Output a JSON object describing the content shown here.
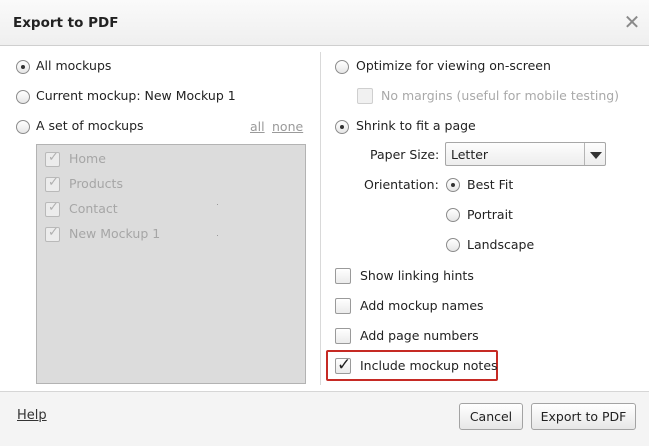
{
  "dialog": {
    "title": "Export to PDF",
    "close_icon": "close-icon"
  },
  "left": {
    "scope_options": [
      {
        "label": "All mockups",
        "selected": true
      },
      {
        "label": "Current mockup: New Mockup 1",
        "selected": false
      },
      {
        "label": "A set of mockups",
        "selected": false
      }
    ],
    "select_all_link": "all",
    "select_none_link": "none",
    "mockup_list": [
      {
        "label": "Home",
        "checked": true
      },
      {
        "label": "Products",
        "checked": true
      },
      {
        "label": "Contact",
        "checked": true
      },
      {
        "label": "New Mockup 1",
        "checked": true
      }
    ]
  },
  "right": {
    "optimize_label": "Optimize for viewing on-screen",
    "no_margins_label": "No margins (useful for mobile testing)",
    "shrink_label": "Shrink to fit a page",
    "paper_size_label": "Paper Size:",
    "paper_size_value": "Letter",
    "orientation_label": "Orientation:",
    "orientation_options": [
      {
        "label": "Best Fit",
        "selected": true
      },
      {
        "label": "Portrait",
        "selected": false
      },
      {
        "label": "Landscape",
        "selected": false
      }
    ],
    "checkbox_options": [
      {
        "label": "Show linking hints",
        "checked": false
      },
      {
        "label": "Add mockup names",
        "checked": false
      },
      {
        "label": "Add page numbers",
        "checked": false
      },
      {
        "label": "Include mockup notes",
        "checked": true
      }
    ],
    "highlight_color": "#c62a24"
  },
  "footer": {
    "help_link": "Help",
    "cancel_label": "Cancel",
    "export_label": "Export to PDF"
  }
}
